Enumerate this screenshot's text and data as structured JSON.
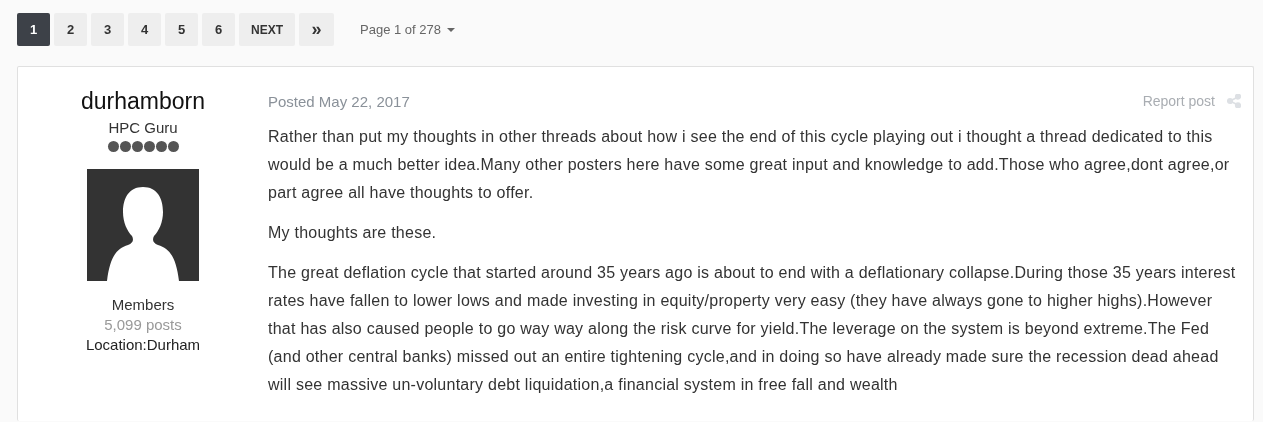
{
  "pagination": {
    "pages": [
      {
        "label": "1",
        "selected": true
      },
      {
        "label": "2",
        "selected": false
      },
      {
        "label": "3",
        "selected": false
      },
      {
        "label": "4",
        "selected": false
      },
      {
        "label": "5",
        "selected": false
      },
      {
        "label": "6",
        "selected": false
      }
    ],
    "next": "NEXT",
    "last": "»",
    "page_menu": "Page 1 of 278"
  },
  "post": {
    "author": {
      "name": "durhamborn",
      "title": "HPC Guru",
      "stars": 6,
      "group": "Members",
      "posts": "5,099 posts",
      "location": "Location:Durham"
    },
    "posted": "Posted May 22, 2017",
    "report": "Report post",
    "paragraphs": [
      "Rather than put my thoughts in other threads about how i see the end of this cycle playing out i thought a thread dedicated to this would be a much better idea.Many other posters here have some great input and knowledge to add.Those who agree,dont agree,or part agree all have thoughts to offer.",
      "My thoughts are these.",
      "The great deflation cycle that started around 35 years ago is about to end with a deflationary collapse.During those 35 years interest rates have fallen to lower lows and made investing in equity/property very easy (they have always gone to higher highs).However that has also caused people to go way way along the risk curve for yield.The leverage on the system is beyond extreme.The Fed (and other central banks) missed out an entire tightening cycle,and in doing so have already made sure the recession dead ahead will see massive un-voluntary debt liquidation,a financial system in free fall and wealth"
    ]
  }
}
